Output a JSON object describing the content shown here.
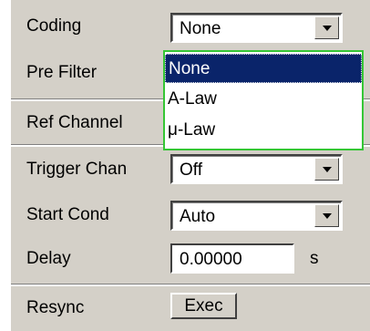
{
  "rows": {
    "coding": {
      "label": "Coding",
      "value": "None"
    },
    "pre_filter": {
      "label": "Pre Filter"
    },
    "ref_channel": {
      "label": "Ref Channel"
    },
    "trigger_chan": {
      "label": "Trigger Chan",
      "value": "Off"
    },
    "start_cond": {
      "label": "Start Cond",
      "value": "Auto"
    },
    "delay": {
      "label": "Delay",
      "value": "0.00000",
      "unit": "s"
    },
    "resync": {
      "label": "Resync",
      "button": "Exec"
    }
  },
  "dropdown": {
    "options": [
      "None",
      "A-Law",
      "μ-Law"
    ],
    "selected": "None"
  },
  "colors": {
    "panel": "#d4d0c8",
    "selection": "#0a246a",
    "dropdown_border": "#35c635"
  }
}
